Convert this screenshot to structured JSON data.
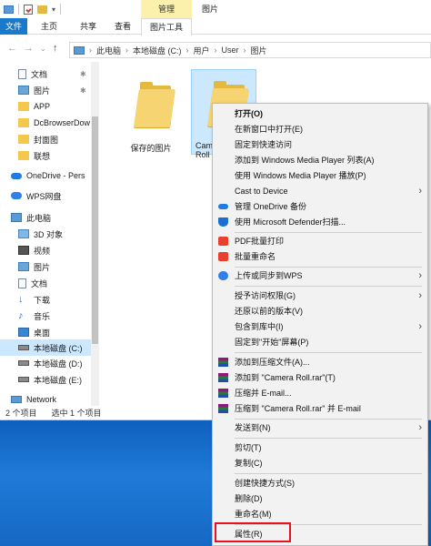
{
  "window": {
    "context_group": "管理",
    "title": "图片"
  },
  "ribbon": {
    "tabs": [
      "文件",
      "主页",
      "共享",
      "查看",
      "图片工具"
    ]
  },
  "address": {
    "path": [
      "此电脑",
      "本地磁盘 (C:)",
      "用户",
      "User",
      "图片"
    ]
  },
  "sidebar": {
    "items": [
      {
        "label": "文档",
        "icon": "document-icon",
        "pinned": true
      },
      {
        "label": "图片",
        "icon": "pictures-icon",
        "pinned": true
      },
      {
        "label": "APP",
        "icon": "folder-icon"
      },
      {
        "label": "DcBrowserDow",
        "icon": "folder-icon"
      },
      {
        "label": "封面图",
        "icon": "folder-icon"
      },
      {
        "label": "联想",
        "icon": "folder-icon"
      },
      {
        "label": "OneDrive - Pers",
        "icon": "onedrive-icon"
      },
      {
        "label": "WPS网盘",
        "icon": "wps-cloud-icon"
      },
      {
        "label": "此电脑",
        "icon": "computer-icon"
      },
      {
        "label": "3D 对象",
        "icon": "3d-objects-icon"
      },
      {
        "label": "视频",
        "icon": "video-icon"
      },
      {
        "label": "图片",
        "icon": "pictures-icon"
      },
      {
        "label": "文档",
        "icon": "document-icon"
      },
      {
        "label": "下载",
        "icon": "download-icon"
      },
      {
        "label": "音乐",
        "icon": "music-icon"
      },
      {
        "label": "桌面",
        "icon": "desktop-icon"
      },
      {
        "label": "本地磁盘 (C:)",
        "icon": "drive-icon",
        "selected": true
      },
      {
        "label": "本地磁盘 (D:)",
        "icon": "drive-icon"
      },
      {
        "label": "本地磁盘 (E:)",
        "icon": "drive-icon"
      },
      {
        "label": "Network",
        "icon": "network-icon"
      }
    ]
  },
  "files": [
    {
      "label": "保存的图片",
      "selected": false
    },
    {
      "label": "Camera Roll",
      "selected": true
    }
  ],
  "status": {
    "count": "2 个项目",
    "selection": "选中 1 个项目"
  },
  "context_menu": {
    "items": [
      {
        "label": "打开(O)",
        "bold": true
      },
      {
        "label": "在新窗口中打开(E)"
      },
      {
        "label": "固定到快速访问"
      },
      {
        "label": "添加到 Windows Media Player 列表(A)"
      },
      {
        "label": "使用 Windows Media Player 播放(P)"
      },
      {
        "label": "Cast to Device",
        "submenu": true
      },
      {
        "label": "管理 OneDrive 备份",
        "icon": "onedrive-icon"
      },
      {
        "label": "使用 Microsoft Defender扫描...",
        "icon": "defender-icon"
      },
      {
        "label": "PDF批量打印",
        "icon": "wps-pdf-icon"
      },
      {
        "label": "批量重命名",
        "icon": "wps-rename-icon"
      },
      {
        "label": "上传或同步到WPS",
        "icon": "wps-cloud-icon",
        "submenu": true
      },
      {
        "label": "授予访问权限(G)",
        "submenu": true
      },
      {
        "label": "还原以前的版本(V)"
      },
      {
        "label": "包含到库中(I)",
        "submenu": true
      },
      {
        "label": "固定到\"开始\"屏幕(P)"
      },
      {
        "label": "添加到压缩文件(A)...",
        "icon": "winrar-icon"
      },
      {
        "label": "添加到 \"Camera Roll.rar\"(T)",
        "icon": "winrar-icon"
      },
      {
        "label": "压缩并 E-mail...",
        "icon": "winrar-icon"
      },
      {
        "label": "压缩到 \"Camera Roll.rar\" 并 E-mail",
        "icon": "winrar-icon"
      },
      {
        "label": "发送到(N)",
        "submenu": true
      },
      {
        "label": "剪切(T)"
      },
      {
        "label": "复制(C)"
      },
      {
        "label": "创建快捷方式(S)"
      },
      {
        "label": "删除(D)"
      },
      {
        "label": "重命名(M)"
      },
      {
        "label": "属性(R)",
        "highlighted": true
      }
    ]
  },
  "colors": {
    "accent": "#1979ca",
    "selection": "#cce8ff",
    "highlight_box": "#e81123",
    "desktop": "#1566c2"
  }
}
